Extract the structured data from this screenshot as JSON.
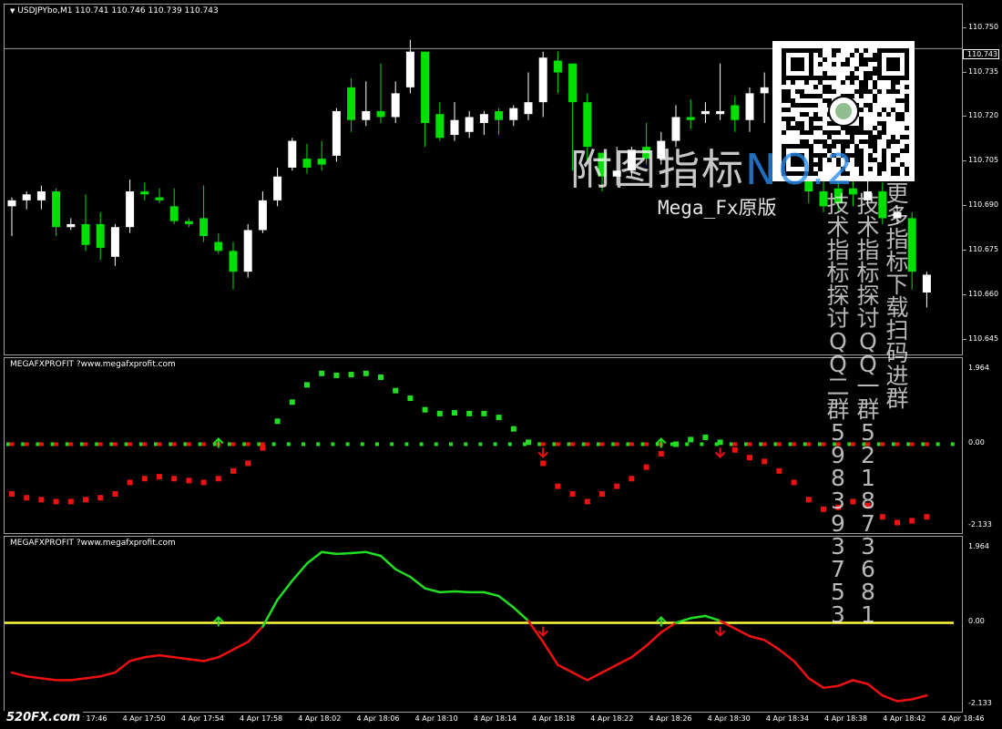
{
  "main": {
    "title": "USDJPYbo,M1  110.741 110.746 110.739 110.743",
    "menu_icon": "triangle-down-icon",
    "price_levels": [
      "110.750",
      "110.735",
      "110.720",
      "110.705",
      "110.690",
      "110.675",
      "110.660",
      "110.645"
    ],
    "current_price": "110.743"
  },
  "indicator1": {
    "title": "MEGAFXPROFIT ?www.megafxprofit.com",
    "levels": [
      "1.964",
      "0.00",
      "-2.133"
    ]
  },
  "indicator2": {
    "title": "MEGAFXPROFIT ?www.megafxprofit.com",
    "levels": [
      "1.964",
      "0.00",
      "-2.133"
    ]
  },
  "time_axis": [
    "4 Apr 17:46",
    "4 Apr 17:50",
    "4 Apr 17:54",
    "4 Apr 17:58",
    "4 Apr 18:02",
    "4 Apr 18:06",
    "4 Apr 18:10",
    "4 Apr 18:14",
    "4 Apr 18:18",
    "4 Apr 18:22",
    "4 Apr 18:26",
    "4 Apr 18:30",
    "4 Apr 18:34",
    "4 Apr 18:38",
    "4 Apr 18:42",
    "4 Apr 18:46"
  ],
  "watermarks": {
    "site_logo": "520FX.com",
    "headline_cn": "附图指标",
    "headline_no": "NO.2",
    "subtitle": "Mega_Fx原版",
    "col1": "更多指标下载扫码进群",
    "col2": "技术指标探讨QQ一群 521873681",
    "col3": "技术指标探讨QQ二群 598393753"
  },
  "colors": {
    "bull": "#00e000",
    "bear": "#ffffff",
    "osc_up": "#22dd22",
    "osc_down": "#ee1111",
    "zero_line": "#ffff40",
    "grid": "#a0a0a0"
  },
  "chart_data": [
    {
      "type": "candlestick",
      "title": "USDJPYbo,M1",
      "ylim": [
        110.642,
        110.756
      ],
      "last_price": 110.743,
      "candles": [
        {
          "o": 110.69,
          "h": 110.693,
          "l": 110.68,
          "c": 110.692
        },
        {
          "o": 110.692,
          "h": 110.695,
          "l": 110.689,
          "c": 110.694
        },
        {
          "o": 110.692,
          "h": 110.697,
          "l": 110.689,
          "c": 110.695
        },
        {
          "o": 110.695,
          "h": 110.696,
          "l": 110.68,
          "c": 110.683
        },
        {
          "o": 110.683,
          "h": 110.686,
          "l": 110.682,
          "c": 110.684
        },
        {
          "o": 110.684,
          "h": 110.694,
          "l": 110.675,
          "c": 110.677
        },
        {
          "o": 110.684,
          "h": 110.688,
          "l": 110.672,
          "c": 110.676
        },
        {
          "o": 110.673,
          "h": 110.684,
          "l": 110.67,
          "c": 110.683
        },
        {
          "o": 110.683,
          "h": 110.699,
          "l": 110.681,
          "c": 110.695
        },
        {
          "o": 110.695,
          "h": 110.698,
          "l": 110.692,
          "c": 110.694
        },
        {
          "o": 110.693,
          "h": 110.696,
          "l": 110.691,
          "c": 110.692
        },
        {
          "o": 110.69,
          "h": 110.696,
          "l": 110.684,
          "c": 110.685
        },
        {
          "o": 110.685,
          "h": 110.686,
          "l": 110.683,
          "c": 110.684
        },
        {
          "o": 110.686,
          "h": 110.697,
          "l": 110.678,
          "c": 110.68
        },
        {
          "o": 110.678,
          "h": 110.681,
          "l": 110.674,
          "c": 110.675
        },
        {
          "o": 110.675,
          "h": 110.678,
          "l": 110.662,
          "c": 110.668
        },
        {
          "o": 110.668,
          "h": 110.684,
          "l": 110.666,
          "c": 110.682
        },
        {
          "o": 110.682,
          "h": 110.695,
          "l": 110.681,
          "c": 110.692
        },
        {
          "o": 110.692,
          "h": 110.703,
          "l": 110.69,
          "c": 110.7
        },
        {
          "o": 110.703,
          "h": 110.713,
          "l": 110.702,
          "c": 110.712
        },
        {
          "o": 110.706,
          "h": 110.711,
          "l": 110.701,
          "c": 110.703
        },
        {
          "o": 110.706,
          "h": 110.712,
          "l": 110.702,
          "c": 110.704
        },
        {
          "o": 110.707,
          "h": 110.723,
          "l": 110.705,
          "c": 110.722
        },
        {
          "o": 110.73,
          "h": 110.733,
          "l": 110.715,
          "c": 110.719
        },
        {
          "o": 110.719,
          "h": 110.732,
          "l": 110.717,
          "c": 110.722
        },
        {
          "o": 110.722,
          "h": 110.738,
          "l": 110.718,
          "c": 110.72
        },
        {
          "o": 110.72,
          "h": 110.732,
          "l": 110.718,
          "c": 110.728
        },
        {
          "o": 110.73,
          "h": 110.746,
          "l": 110.728,
          "c": 110.742
        },
        {
          "o": 110.742,
          "h": 110.741,
          "l": 110.71,
          "c": 110.718
        },
        {
          "o": 110.721,
          "h": 110.725,
          "l": 110.712,
          "c": 110.713
        },
        {
          "o": 110.714,
          "h": 110.725,
          "l": 110.712,
          "c": 110.719
        },
        {
          "o": 110.715,
          "h": 110.722,
          "l": 110.713,
          "c": 110.72
        },
        {
          "o": 110.718,
          "h": 110.722,
          "l": 110.714,
          "c": 110.721
        },
        {
          "o": 110.722,
          "h": 110.723,
          "l": 110.714,
          "c": 110.719
        },
        {
          "o": 110.719,
          "h": 110.724,
          "l": 110.717,
          "c": 110.723
        },
        {
          "o": 110.721,
          "h": 110.735,
          "l": 110.719,
          "c": 110.725
        },
        {
          "o": 110.725,
          "h": 110.742,
          "l": 110.72,
          "c": 110.74
        },
        {
          "o": 110.739,
          "h": 110.742,
          "l": 110.728,
          "c": 110.735
        },
        {
          "o": 110.738,
          "h": 110.738,
          "l": 110.702,
          "c": 110.725
        },
        {
          "o": 110.725,
          "h": 110.728,
          "l": 110.705,
          "c": 110.71
        },
        {
          "o": 110.708,
          "h": 110.708,
          "l": 110.695,
          "c": 110.7
        },
        {
          "o": 110.7,
          "h": 110.71,
          "l": 110.697,
          "c": 110.702
        },
        {
          "o": 110.702,
          "h": 110.71,
          "l": 110.7,
          "c": 110.709
        },
        {
          "o": 110.71,
          "h": 110.718,
          "l": 110.704,
          "c": 110.706
        },
        {
          "o": 110.706,
          "h": 110.715,
          "l": 110.704,
          "c": 110.712
        },
        {
          "o": 110.712,
          "h": 110.724,
          "l": 110.71,
          "c": 110.72
        },
        {
          "o": 110.72,
          "h": 110.726,
          "l": 110.716,
          "c": 110.719
        },
        {
          "o": 110.721,
          "h": 110.725,
          "l": 110.718,
          "c": 110.722
        },
        {
          "o": 110.721,
          "h": 110.738,
          "l": 110.719,
          "c": 110.722
        },
        {
          "o": 110.724,
          "h": 110.727,
          "l": 110.715,
          "c": 110.719
        },
        {
          "o": 110.719,
          "h": 110.73,
          "l": 110.715,
          "c": 110.728
        },
        {
          "o": 110.728,
          "h": 110.735,
          "l": 110.718,
          "c": 110.73
        },
        {
          "o": 110.73,
          "h": 110.734,
          "l": 110.713,
          "c": 110.716
        },
        {
          "o": 110.716,
          "h": 110.722,
          "l": 110.7,
          "c": 110.705
        },
        {
          "o": 110.705,
          "h": 110.709,
          "l": 110.691,
          "c": 110.695
        },
        {
          "o": 110.695,
          "h": 110.7,
          "l": 110.688,
          "c": 110.69
        },
        {
          "o": 110.696,
          "h": 110.702,
          "l": 110.688,
          "c": 110.691
        },
        {
          "o": 110.696,
          "h": 110.702,
          "l": 110.69,
          "c": 110.694
        },
        {
          "o": 110.692,
          "h": 110.7,
          "l": 110.69,
          "c": 110.695
        },
        {
          "o": 110.695,
          "h": 110.698,
          "l": 110.684,
          "c": 110.686
        },
        {
          "o": 110.686,
          "h": 110.69,
          "l": 110.684,
          "c": 110.688
        },
        {
          "o": 110.686,
          "h": 110.688,
          "l": 110.662,
          "c": 110.668
        },
        {
          "o": 110.661,
          "h": 110.668,
          "l": 110.656,
          "c": 110.667
        }
      ]
    },
    {
      "type": "scatter",
      "title": "MEGAFXPROFIT ?www.megafxprofit.com",
      "ylim": [
        -2.133,
        1.964
      ],
      "series": [
        {
          "values": [
            -1.3,
            -1.4,
            -1.45,
            -1.5,
            -1.5,
            -1.45,
            -1.4,
            -1.3,
            -1.0,
            -0.9,
            -0.85,
            -0.9,
            -0.95,
            -1.0,
            -0.9,
            -0.7,
            -0.5,
            -0.1,
            0.6,
            1.1,
            1.55,
            1.85,
            1.8,
            1.82,
            1.85,
            1.75,
            1.4,
            1.2,
            0.9,
            0.8,
            0.82,
            0.8,
            0.8,
            0.7,
            0.4,
            0.05,
            -0.5,
            -1.1,
            -1.3,
            -1.5,
            -1.3,
            -1.1,
            -0.9,
            -0.6,
            -0.25,
            0.0,
            0.12,
            0.18,
            0.05,
            -0.15,
            -0.35,
            -0.45,
            -0.7,
            -1.0,
            -1.45,
            -1.7,
            -1.65,
            -1.5,
            -1.6,
            -1.9,
            -2.05,
            -2.0,
            -1.9
          ]
        }
      ],
      "arrows": [
        {
          "index": 14,
          "direction": "up"
        },
        {
          "index": 36,
          "direction": "down"
        },
        {
          "index": 44,
          "direction": "up"
        },
        {
          "index": 48,
          "direction": "down"
        }
      ]
    },
    {
      "type": "line",
      "title": "MEGAFXPROFIT ?www.megafxprofit.com",
      "ylim": [
        -2.133,
        1.964
      ],
      "series": [
        {
          "values": [
            -1.3,
            -1.4,
            -1.45,
            -1.5,
            -1.5,
            -1.45,
            -1.4,
            -1.3,
            -1.0,
            -0.9,
            -0.85,
            -0.9,
            -0.95,
            -1.0,
            -0.9,
            -0.7,
            -0.5,
            -0.1,
            0.6,
            1.1,
            1.55,
            1.85,
            1.8,
            1.82,
            1.85,
            1.75,
            1.4,
            1.2,
            0.9,
            0.8,
            0.82,
            0.8,
            0.8,
            0.7,
            0.4,
            0.05,
            -0.5,
            -1.1,
            -1.3,
            -1.5,
            -1.3,
            -1.1,
            -0.9,
            -0.6,
            -0.25,
            0.0,
            0.12,
            0.18,
            0.05,
            -0.15,
            -0.35,
            -0.45,
            -0.7,
            -1.0,
            -1.45,
            -1.7,
            -1.65,
            -1.5,
            -1.6,
            -1.9,
            -2.05,
            -2.0,
            -1.9
          ]
        }
      ],
      "arrows": [
        {
          "index": 14,
          "direction": "up"
        },
        {
          "index": 36,
          "direction": "down"
        },
        {
          "index": 44,
          "direction": "up"
        },
        {
          "index": 48,
          "direction": "down"
        }
      ]
    }
  ]
}
